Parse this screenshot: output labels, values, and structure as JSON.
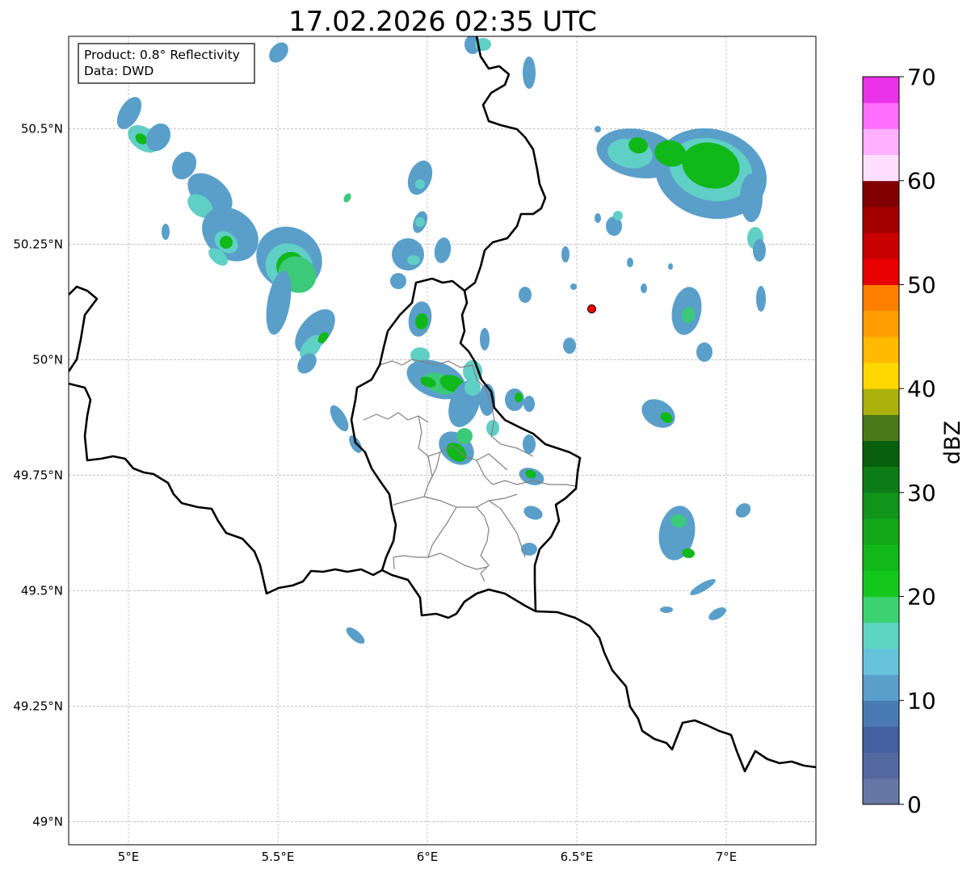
{
  "title": "17.02.2026 02:35 UTC",
  "info_box": {
    "product": "Product: 0.8° Reflectivity",
    "data": "Data: DWD"
  },
  "map": {
    "lon_range": [
      4.8,
      7.3
    ],
    "lat_range": [
      48.95,
      50.7
    ],
    "lon_ticks": [
      {
        "value": 5.0,
        "label": "5°E"
      },
      {
        "value": 5.5,
        "label": "5.5°E"
      },
      {
        "value": 6.0,
        "label": "6°E"
      },
      {
        "value": 6.5,
        "label": "6.5°E"
      },
      {
        "value": 7.0,
        "label": "7°E"
      }
    ],
    "lat_ticks": [
      {
        "value": 50.5,
        "label": "50.5°N"
      },
      {
        "value": 50.25,
        "label": "50.25°N"
      },
      {
        "value": 50.0,
        "label": "50°N"
      },
      {
        "value": 49.75,
        "label": "49.75°N"
      },
      {
        "value": 49.5,
        "label": "49.5°N"
      },
      {
        "value": 49.25,
        "label": "49.25°N"
      },
      {
        "value": 49.0,
        "label": "49°N"
      }
    ],
    "gridlines": true,
    "radar_site": {
      "lon": 6.55,
      "lat": 50.11,
      "color": "#ff0000"
    }
  },
  "colorbar": {
    "label": "dBZ",
    "min": 0,
    "max": 70,
    "ticks": [
      0,
      10,
      20,
      30,
      40,
      50,
      60,
      70
    ],
    "colors": [
      "#6677a7",
      "#54699f",
      "#4460a0",
      "#4a7ab3",
      "#5a9fca",
      "#67c3dc",
      "#5ed5c2",
      "#3bd271",
      "#13c81b",
      "#12b81a",
      "#12a818",
      "#10941a",
      "#0c7d16",
      "#095f0d",
      "#497917",
      "#acb20c",
      "#ffd700",
      "#ffba00",
      "#ff9d00",
      "#ff7f00",
      "#e80000",
      "#c80000",
      "#a50000",
      "#800000",
      "#ffdfff",
      "#ffb0ff",
      "#ff6eff",
      "#ea32ea"
    ]
  },
  "echo_colors": {
    "light": "#4b6ca8",
    "light2": "#5a9fca",
    "mid": "#60cfc6",
    "mid2": "#3cc97a",
    "core": "#11b81a"
  }
}
